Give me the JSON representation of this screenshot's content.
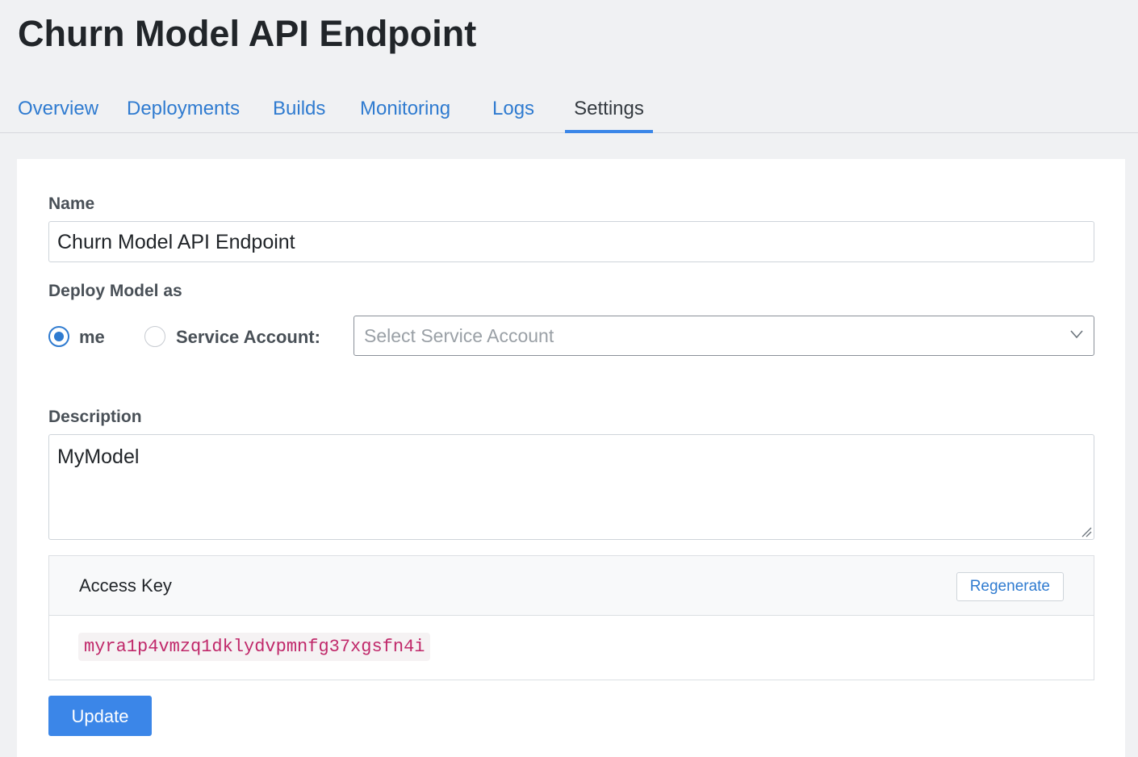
{
  "page": {
    "title": "Churn Model API Endpoint"
  },
  "tabs": [
    {
      "label": "Overview",
      "active": false
    },
    {
      "label": "Deployments",
      "active": false
    },
    {
      "label": "Builds",
      "active": false
    },
    {
      "label": "Monitoring",
      "active": false
    },
    {
      "label": "Logs",
      "active": false
    },
    {
      "label": "Settings",
      "active": true
    }
  ],
  "form": {
    "name_label": "Name",
    "name_value": "Churn Model API Endpoint",
    "deploy_label": "Deploy Model as",
    "deploy_options": [
      {
        "label": "me",
        "checked": true
      },
      {
        "label": "Service Account:",
        "checked": false
      }
    ],
    "service_account_placeholder": "Select Service Account",
    "description_label": "Description",
    "description_value": "MyModel",
    "update_label": "Update"
  },
  "access_key": {
    "title": "Access Key",
    "regenerate_label": "Regenerate",
    "value": "myra1p4vmzq1dklydvpmnfg37xgsfn4i"
  },
  "colors": {
    "link": "#2f7bd0",
    "accent": "#3b86e8",
    "key_text": "#c0286a",
    "page_bg": "#f0f1f3"
  },
  "icons": {
    "select_chevron": "chevron-down-icon",
    "textarea_resize": "resize-handle-icon"
  }
}
